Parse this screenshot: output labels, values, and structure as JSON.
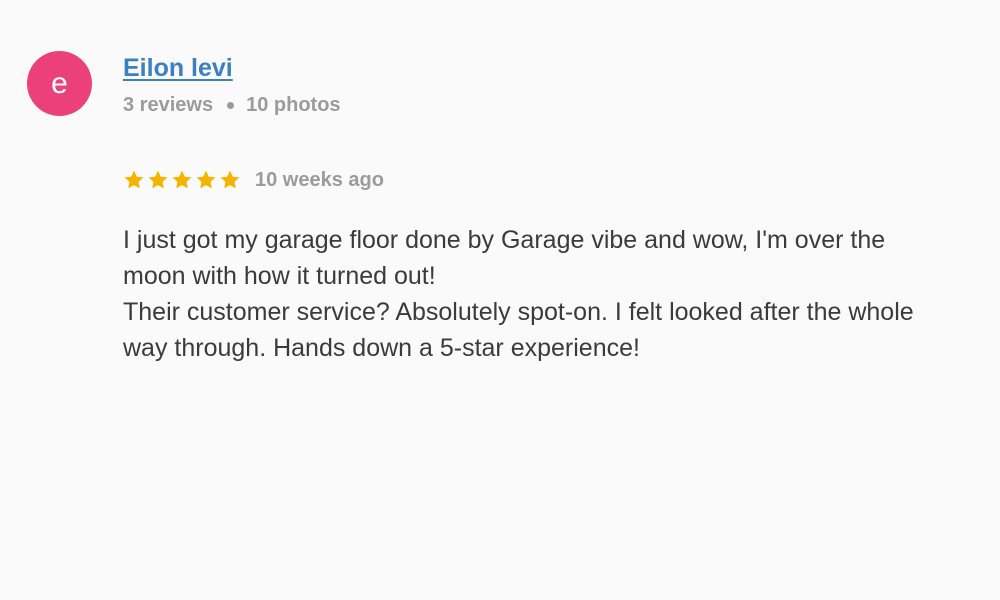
{
  "review": {
    "avatar": {
      "initial": "e",
      "color": "#ec407a"
    },
    "author": {
      "name": "Eilon levi",
      "name_color": "#3b7fc4"
    },
    "meta": {
      "reviews": "3 reviews",
      "photos": "10 photos"
    },
    "rating": {
      "stars": 5,
      "max_stars": 5,
      "star_color": "#f4b400",
      "star_icon": "star-icon"
    },
    "time": "10 weeks ago",
    "body": {
      "paragraph_1": "I just got my garage floor done by Garage vibe and wow, I'm over the moon with how it turned out!",
      "paragraph_2": "Their customer service? Absolutely spot-on. I felt looked after the whole way through. Hands down a 5-star experience!"
    }
  }
}
